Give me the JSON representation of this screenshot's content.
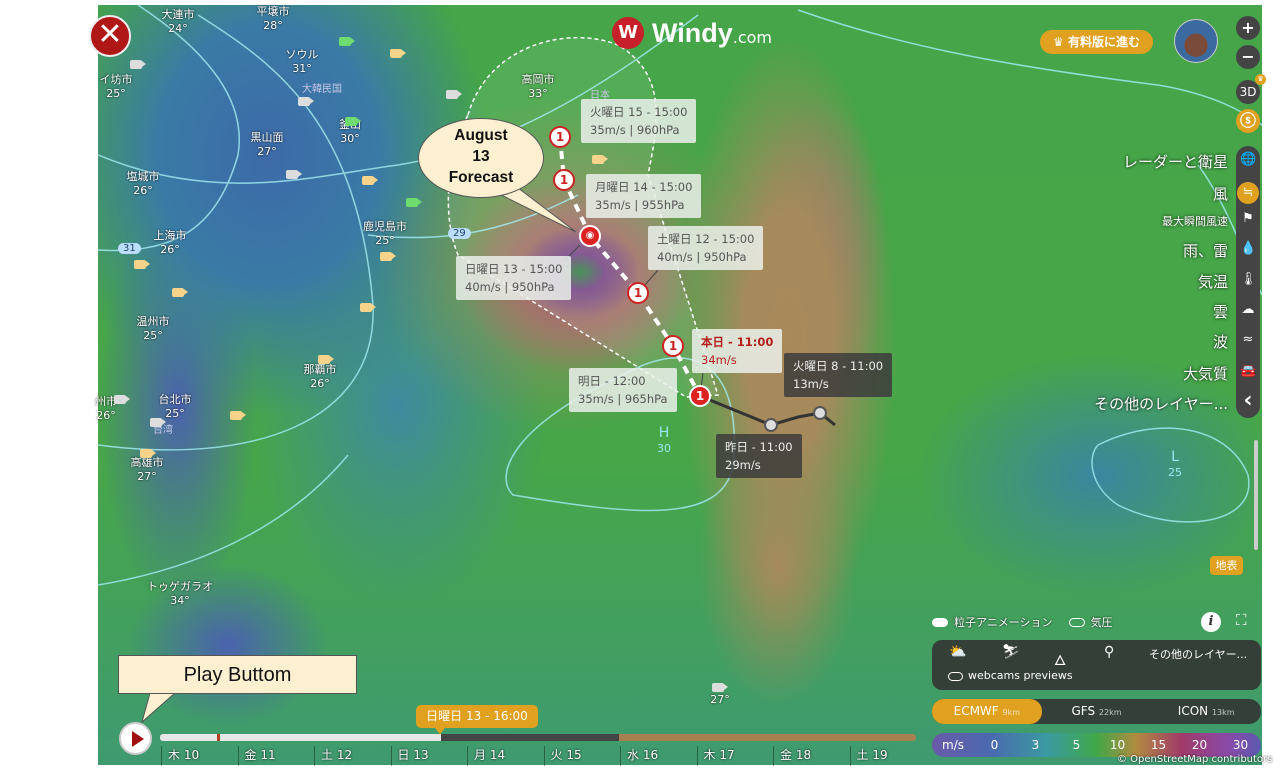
{
  "app": {
    "logo_text": "Windy",
    "logo_suffix": ".com",
    "premium_button": "有料版に進む",
    "accent": "#e0a020"
  },
  "map": {
    "cities": [
      {
        "name": "大連市",
        "temp": "24°"
      },
      {
        "name": "平壌市",
        "temp": "28°"
      },
      {
        "name": "イ坊市",
        "temp": "25°"
      },
      {
        "name": "ソウル",
        "temp": "31°"
      },
      {
        "name": "釜山",
        "temp": "30°"
      },
      {
        "name": "黒山面",
        "temp": "27°"
      },
      {
        "name": "塩城市",
        "temp": "26°"
      },
      {
        "name": "上海市",
        "temp": "26°"
      },
      {
        "name": "鹿児島市",
        "temp": "25°"
      },
      {
        "name": "高岡市",
        "temp": "33°"
      },
      {
        "name": "温州市",
        "temp": "25°"
      },
      {
        "name": "那覇市",
        "temp": "26°"
      },
      {
        "name": "台北市",
        "temp": "25°"
      },
      {
        "name": "高雄市",
        "temp": "27°"
      },
      {
        "name": "州市",
        "temp": "26°"
      },
      {
        "name": "トゥゲガラオ",
        "temp": "34°"
      },
      {
        "name": "",
        "temp": "27°"
      }
    ],
    "countries": [
      "大韓民国",
      "日本",
      "台湾"
    ],
    "isobars": [
      "29",
      "31"
    ],
    "pressure_centers": [
      {
        "type": "H",
        "value": "30"
      },
      {
        "type": "L",
        "value": "25"
      }
    ]
  },
  "storm": {
    "category": "1",
    "labels": [
      {
        "time": "火曜日 15 - 15:00",
        "info": "35m/s | 960hPa"
      },
      {
        "time": "月曜日 14 - 15:00",
        "info": "35m/s | 955hPa"
      },
      {
        "time": "土曜日 12 - 15:00",
        "info": "40m/s | 950hPa"
      },
      {
        "time": "日曜日 13 - 15:00",
        "info": "40m/s | 950hPa"
      },
      {
        "time": "本日 - 11:00",
        "info": "34m/s"
      },
      {
        "time": "明日 - 12:00",
        "info": "35m/s | 965hPa"
      },
      {
        "time": "火曜日 8 - 11:00",
        "info": "13m/s"
      },
      {
        "time": "昨日 - 11:00",
        "info": "29m/s"
      }
    ]
  },
  "annotations": {
    "forecast_callout": [
      "August",
      "13",
      "Forecast"
    ],
    "play_callout": "Play Buttom"
  },
  "controls": {
    "zoom_in": "+",
    "zoom_out": "−",
    "three_d": "3D"
  },
  "layers": [
    {
      "label": "レーダーと衛星",
      "icon": "globe-icon"
    },
    {
      "label": "風",
      "icon": "wind-icon",
      "active": true
    },
    {
      "label": "最大瞬間風速",
      "icon": "flag-icon"
    },
    {
      "label": "雨、雷",
      "icon": "drop-icon"
    },
    {
      "label": "気温",
      "icon": "thermometer-icon"
    },
    {
      "label": "雲",
      "icon": "cloud-icon"
    },
    {
      "label": "波",
      "icon": "waves-icon"
    },
    {
      "label": "大気質",
      "icon": "car-icon"
    },
    {
      "label": "その他のレイヤー...",
      "icon": "chevron-left-icon"
    }
  ],
  "surface_badge": "地表",
  "toggles": {
    "particles": "粒子アニメーション",
    "pressure": "気圧",
    "webcams": "webcams previews",
    "more_layers": "その他のレイヤー..."
  },
  "models": [
    {
      "name": "ECMWF",
      "res": "9km",
      "active": true
    },
    {
      "name": "GFS",
      "res": "22km"
    },
    {
      "name": "ICON",
      "res": "13km"
    }
  ],
  "legend": {
    "unit": "m/s",
    "values": [
      "0",
      "3",
      "5",
      "10",
      "15",
      "20",
      "30"
    ]
  },
  "credit": "© OpenStreetMap contributors",
  "timeline": {
    "current": "日曜日 13 - 16:00",
    "days": [
      "木 10",
      "金 11",
      "土 12",
      "日 13",
      "月 14",
      "火 15",
      "水 16",
      "木 17",
      "金 18",
      "土 19"
    ],
    "progress_percent": 37
  }
}
